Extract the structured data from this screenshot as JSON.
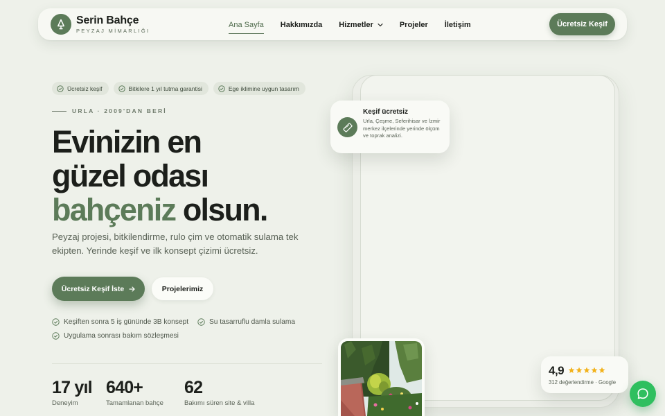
{
  "brand": {
    "name": "Serin Bahçe",
    "subtitle": "PEYZAJ MİMARLIĞI",
    "logo_icon": "tree-icon"
  },
  "nav": {
    "links": [
      {
        "label": "Ana Sayfa",
        "active": true
      },
      {
        "label": "Hakkımızda"
      },
      {
        "label": "Hizmetler",
        "has_dropdown": true
      },
      {
        "label": "Projeler"
      },
      {
        "label": "İletişim"
      }
    ],
    "cta": "Ücretsiz Keşif"
  },
  "hero": {
    "chips": [
      "Ücretsiz keşif",
      "Bitkilere 1 yıl tutma garantisi",
      "Ege iklimine uygun tasarım"
    ],
    "eyebrow": "URLA · 2009'DAN BERİ",
    "headline": {
      "line1": "Evinizin en",
      "line2": "güzel odası",
      "accent": "bahçeniz",
      "tail": " olsun."
    },
    "lead": "Peyzaj projesi, bitkilendirme, rulo çim ve otomatik sulama tek ekipten. Yerinde keşif ve ilk konsept çizimi ücretsiz.",
    "primary_button": "Ücretsiz Keşif İste",
    "secondary_button": "Projelerimiz",
    "features": [
      "Keşiften sonra 5 iş gününde 3B konsept",
      "Su tasarruflu damla sulama",
      "Uygulama sonrası bakım sözleşmesi"
    ],
    "stats": [
      {
        "value": "17 yıl",
        "label": "Deneyim"
      },
      {
        "value": "640+",
        "label": "Tamamlanan bahçe"
      },
      {
        "value": "62",
        "label": "Bakımı süren site & villa"
      }
    ]
  },
  "kesif_card": {
    "title": "Keşif ücretsiz",
    "text": "Urla, Çeşme, Seferihisar ve İzmir merkez ilçelerinde yerinde ölçüm ve toprak analizi.",
    "icon": "ruler-icon"
  },
  "rating": {
    "score": "4,9",
    "stars": 5,
    "caption": "312 değerlendirme · Google"
  },
  "colors": {
    "accent": "#5c7b59",
    "background": "#eef1ea",
    "star": "#f2b21b",
    "whatsapp": "#2fbf5f"
  }
}
